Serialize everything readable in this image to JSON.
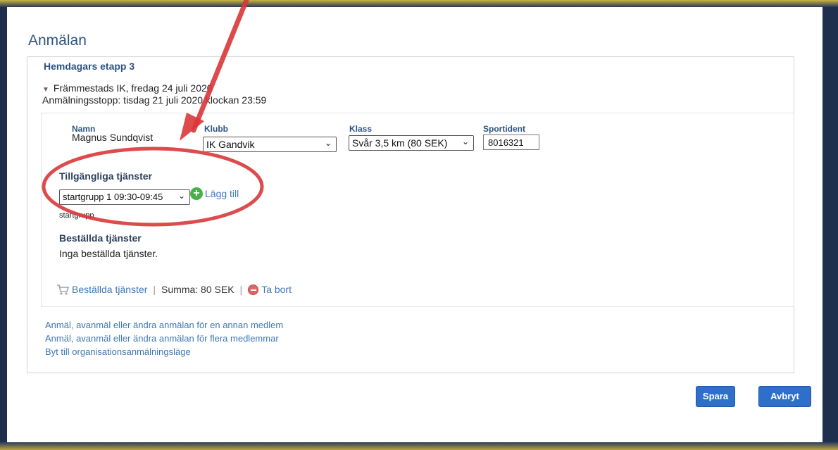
{
  "page": {
    "title": "Anmälan"
  },
  "event": {
    "legend": "Hemdagars etapp 3",
    "organizer_date": "Främmestads IK, fredag 24 juli 2020",
    "deadline": "Anmälningsstopp: tisdag 21 juli 2020 klockan 23:59"
  },
  "entry": {
    "columns": {
      "name": "Namn",
      "club": "Klubb",
      "class": "Klass",
      "sportident": "Sportident"
    },
    "name_value": "Magnus Sundqvist",
    "club_value": "IK Gandvik",
    "class_value": "Svår 3,5 km (80 SEK)",
    "sportident_value": "8016321"
  },
  "services": {
    "available_heading": "Tillgängliga tjänster",
    "select_value": "startgrupp 1 09:30-09:45",
    "add_label": "Lägg till",
    "service_type_caption": "startgrupp",
    "ordered_heading": "Beställda tjänster",
    "ordered_empty": "Inga beställda tjänster."
  },
  "summary": {
    "cart_link": "Beställda tjänster",
    "sum_label": "Summa: 80 SEK",
    "remove_label": "Ta bort"
  },
  "links": [
    "Anmäl, avanmäl eller ändra anmälan för en annan medlem",
    "Anmäl, avanmäl eller ändra anmälan för flera medlemmar",
    "Byt till organisationsanmälningsläge"
  ],
  "buttons": {
    "save": "Spara",
    "cancel": "Avbryt"
  },
  "icons": {
    "expand": "triangle-down-icon",
    "add": "plus-circle-icon",
    "cart": "cart-icon",
    "remove": "remove-circle-icon"
  },
  "colors": {
    "accent": "#2f6fcc",
    "heading": "#2d5383",
    "link": "#3f78b5",
    "annotation": "#d9373a"
  }
}
